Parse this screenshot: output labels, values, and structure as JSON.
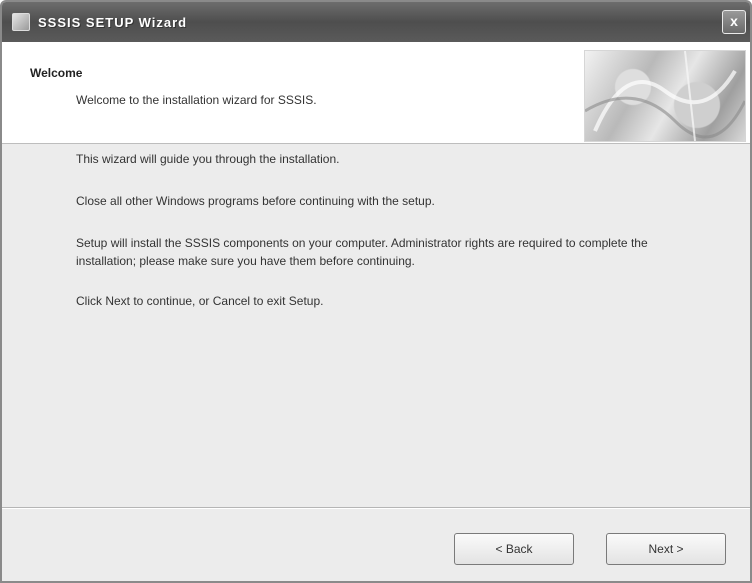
{
  "window": {
    "title": "SSSIS SETUP Wizard"
  },
  "header": {
    "title": "Welcome",
    "subtitle": "Welcome to the installation wizard for SSSIS."
  },
  "content": {
    "paragraphs": [
      "This wizard will guide you through the installation.",
      "Close all other Windows programs before continuing with the setup.",
      "Setup will install the SSSIS components on your computer. Administrator rights are required to complete the installation; please make sure you have them before continuing.",
      "Click Next to continue, or Cancel to exit Setup."
    ]
  },
  "buttons": {
    "back": "< Back",
    "next": "Next >",
    "close": "x"
  },
  "icons": {
    "app": "setup-app-icon",
    "close": "close-icon"
  }
}
